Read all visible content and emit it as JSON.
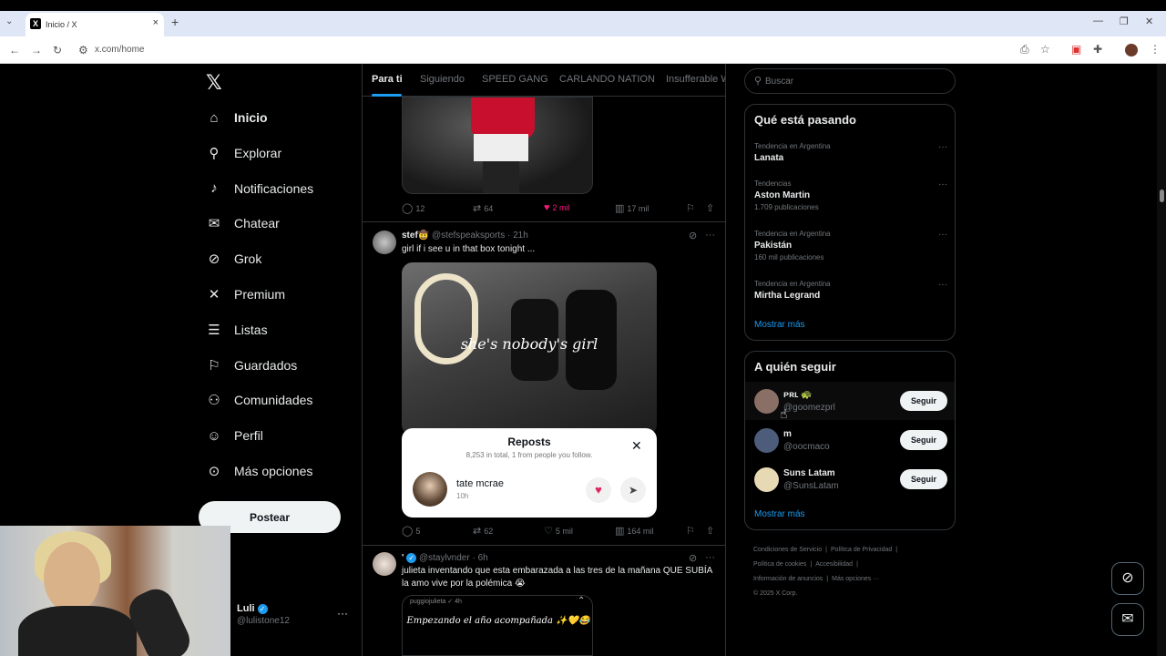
{
  "browser": {
    "tab_title": "Inicio / X",
    "tab_icon": "x-favicon",
    "url": "x.com/home",
    "new_tab": "+",
    "close": "×"
  },
  "nav": {
    "logo": "𝕏",
    "items": [
      {
        "label": "Inicio",
        "icon": "home-icon",
        "glyph": "⌂"
      },
      {
        "label": "Explorar",
        "icon": "search-icon",
        "glyph": "⚲"
      },
      {
        "label": "Notificaciones",
        "icon": "bell-icon",
        "glyph": "♪"
      },
      {
        "label": "Chatear",
        "icon": "mail-icon",
        "glyph": "✉"
      },
      {
        "label": "Grok",
        "icon": "grok-icon",
        "glyph": "⊘"
      },
      {
        "label": "Premium",
        "icon": "x-premium-icon",
        "glyph": "✕"
      },
      {
        "label": "Listas",
        "icon": "list-icon",
        "glyph": "☰"
      },
      {
        "label": "Guardados",
        "icon": "bookmark-icon",
        "glyph": "⚐"
      },
      {
        "label": "Comunidades",
        "icon": "communities-icon",
        "glyph": "⚇"
      },
      {
        "label": "Perfil",
        "icon": "profile-icon",
        "glyph": "☺"
      },
      {
        "label": "Más opciones",
        "icon": "more-circle-icon",
        "glyph": "⊙"
      }
    ],
    "post_button": "Postear"
  },
  "account": {
    "name": "Luli",
    "handle": "@lulistone12",
    "more": "···"
  },
  "timeline": {
    "tabs": [
      "Para ti",
      "Siguiendo",
      "SPEED GANG",
      "CARLANDO NATION",
      "Insufferable W"
    ],
    "post1_stats": {
      "replies": "12",
      "reposts": "64",
      "likes": "2 mil",
      "views": "17 mil"
    },
    "post2": {
      "name": "stef🤠",
      "handle": "@stefspeaksports",
      "time": "· 21h",
      "text": "girl if i see u in that box tonight ...",
      "image_text": "she's nobody's girl",
      "stats": {
        "replies": "5",
        "reposts": "62",
        "likes": "5 mil",
        "views": "164 mil"
      }
    },
    "repost_card": {
      "title": "Reposts",
      "subtitle": "8,253 in total, 1 from people you follow.",
      "close": "✕",
      "user_name": "tate mcrae",
      "user_time": "10h"
    },
    "post3": {
      "name": "'",
      "handle": "@staylvnder",
      "time": "· 6h",
      "text": "julieta inventando que esta embarazada a las tres de la mañana QUE SUBÍA la amo vive por la polémica 😭",
      "image_handle": "puggiojulieta ✓ 4h",
      "image_text": "Empezando el año acompañada ✨💛😂"
    }
  },
  "sidebar": {
    "search_placeholder": "Buscar",
    "trends_title": "Qué está pasando",
    "trends": [
      {
        "context": "Tendencia en Argentina",
        "name": "Lanata",
        "count": ""
      },
      {
        "context": "Tendencias",
        "name": "Aston Martin",
        "count": "1.709 publicaciones"
      },
      {
        "context": "Tendencia en Argentina",
        "name": "Pakistán",
        "count": "160 mil publicaciones"
      },
      {
        "context": "Tendencia en Argentina",
        "name": "Mirtha Legrand",
        "count": ""
      }
    ],
    "trends_more": "Mostrar más",
    "follow_title": "A quién seguir",
    "follow": [
      {
        "name": "ᴘʀʟ 🐢",
        "handle": "@goomezprl",
        "button": "Seguir",
        "color": "#8a6f66"
      },
      {
        "name": "m",
        "handle": "@oocmaco",
        "button": "Seguir",
        "color": "#4d5c7a"
      },
      {
        "name": "Suns Latam",
        "handle": "@SunsLatam",
        "button": "Seguir",
        "color": "#e8d9b5"
      }
    ],
    "follow_more": "Mostrar más",
    "footer": [
      "Condiciones de Servicio",
      "|",
      "Política de Privacidad",
      "|",
      "Política de cookies",
      "|",
      "Accesibilidad",
      "|",
      "Información de anuncios",
      "|",
      "Más opciones ···",
      "© 2025 X Corp."
    ]
  },
  "colors": {
    "accent": "#1d9bf0",
    "like": "#f91880",
    "background": "#000000",
    "border": "#2f3336"
  }
}
